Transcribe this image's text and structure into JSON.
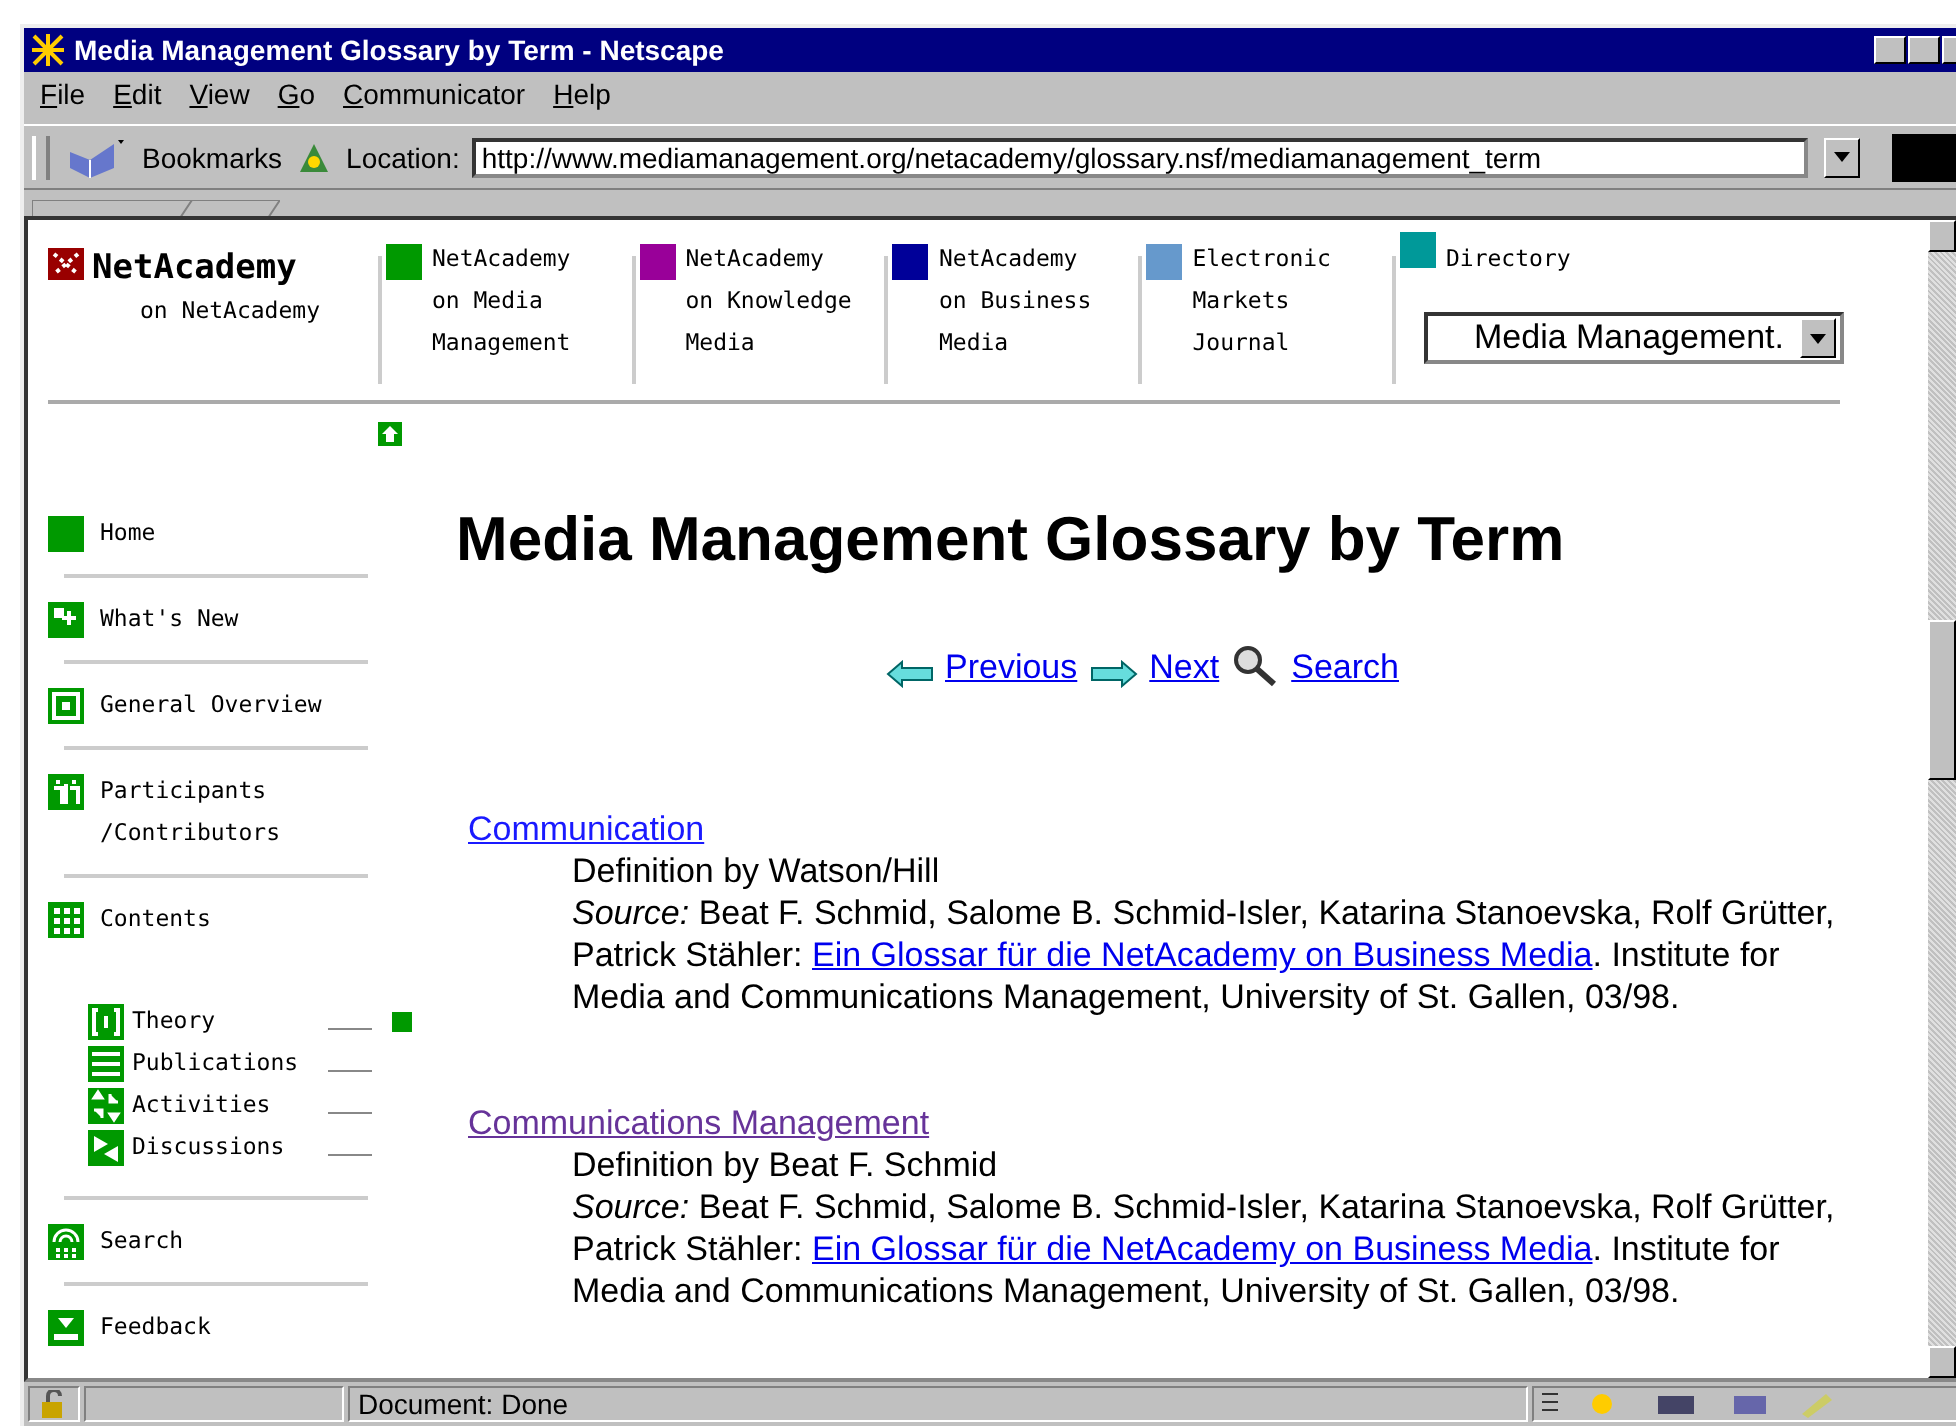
{
  "window": {
    "title": "Media Management Glossary by Term - Netscape"
  },
  "menu": [
    "File",
    "Edit",
    "View",
    "Go",
    "Communicator",
    "Help"
  ],
  "toolbar": {
    "bookmarks": "Bookmarks",
    "location_label": "Location:",
    "url": "http://www.mediamanagement.org/netacademy/glossary.nsf/mediamanagement_term"
  },
  "header": {
    "logo": {
      "title": "NetAcademy",
      "subtitle": "on NetAcademy"
    },
    "columns": [
      {
        "lines": [
          "NetAcademy",
          "on Media",
          "Management"
        ],
        "color": "#009900",
        "selected": true
      },
      {
        "lines": [
          "NetAcademy",
          "on Knowledge",
          "Media"
        ],
        "color": "#990099",
        "selected": false
      },
      {
        "lines": [
          "NetAcademy",
          "on Business",
          "Media"
        ],
        "color": "#000099",
        "selected": false
      },
      {
        "lines": [
          "Electronic",
          "Markets",
          "Journal"
        ],
        "color": "#6699cc",
        "selected": false
      }
    ],
    "directory": {
      "label": "Directory",
      "color": "#009999",
      "value": "Media Management."
    }
  },
  "sidebar": [
    {
      "label": "Home",
      "kind": "home"
    },
    {
      "label": "What's New",
      "kind": "new"
    },
    {
      "label": "General Overview",
      "kind": "overview"
    },
    {
      "label": "Participants /Contributors",
      "kind": "people"
    },
    {
      "label": "Contents",
      "kind": "contents",
      "children": [
        {
          "label": "Theory",
          "kind": "theory",
          "selected": true
        },
        {
          "label": "Publications",
          "kind": "publications",
          "selected": false
        },
        {
          "label": "Activities",
          "kind": "activities",
          "selected": false
        },
        {
          "label": "Discussions",
          "kind": "discussions",
          "selected": false
        }
      ]
    },
    {
      "label": "Search",
      "kind": "search"
    },
    {
      "label": "Feedback",
      "kind": "feedback"
    }
  ],
  "main": {
    "title": "Media Management Glossary by Term",
    "nav": [
      {
        "label": "Previous",
        "kind": "previous"
      },
      {
        "label": "Next",
        "kind": "next"
      },
      {
        "label": "Search",
        "kind": "search"
      }
    ],
    "entries": [
      {
        "term": "Communication",
        "visited": false,
        "definition": "Definition by Watson/Hill",
        "source": "*Source:* Beat F. Schmid, Salome B. Schmid-Isler, Katarina Stanoevska, Rolf Grütter, Patrick Stähler: ",
        "link": "Ein Glossar für die NetAcademy on Business Media",
        "after": ". Institute for Media and Communications Management, University of St. Gallen, 03/98."
      },
      {
        "term": "Communications Management",
        "visited": true,
        "definition": "Definition by Beat F. Schmid",
        "source": "*Source:* Beat F. Schmid, Salome B. Schmid-Isler, Katarina Stanoevska, Rolf Grütter, Patrick Stähler: ",
        "link": "Ein Glossar für die NetAcademy on Business Media",
        "after": ". Institute for Media and Communications Management, University of St. Gallen, 03/98."
      }
    ]
  },
  "status_bar": {
    "text": "Document: Done"
  }
}
